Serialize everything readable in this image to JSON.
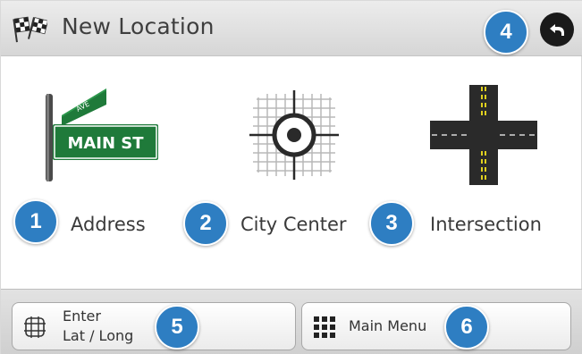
{
  "header": {
    "title": "New Location",
    "flag_icon": "checkered-flag-icon",
    "back_icon": "back-arrow-icon"
  },
  "options": [
    {
      "label": "Address",
      "sign_text": "MAIN ST",
      "sign_small_text": "AVE",
      "icon": "street-sign-icon"
    },
    {
      "label": "City Center",
      "icon": "crosshair-map-icon"
    },
    {
      "label": "Intersection",
      "icon": "road-intersection-icon"
    }
  ],
  "bottom_bar": {
    "latlong_line1": "Enter",
    "latlong_line2": "Lat / Long",
    "latlong_icon": "globe-grid-icon",
    "main_menu_label": "Main Menu",
    "main_menu_icon": "grid-menu-icon"
  },
  "markers": [
    "1",
    "2",
    "3",
    "4",
    "5",
    "6"
  ],
  "colors": {
    "marker_blue": "#2e7ec2",
    "sign_green": "#1f7a3a",
    "road_dark": "#2a2a2a",
    "road_stripe": "#e0d01f"
  }
}
